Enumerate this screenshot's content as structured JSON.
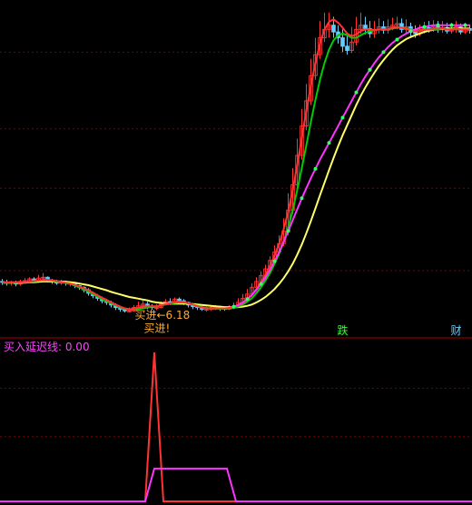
{
  "chart_data": [
    {
      "type": "line",
      "panel": "main",
      "description_note": "",
      "x": [
        0,
        1,
        2,
        3,
        4,
        5,
        6,
        7,
        8,
        9,
        10,
        11,
        12,
        13,
        14,
        15,
        16,
        17,
        18,
        19,
        20,
        21,
        22,
        23,
        24,
        25,
        26,
        27,
        28,
        29,
        30,
        31,
        32,
        33,
        34,
        35,
        36,
        37,
        38,
        39,
        40,
        41,
        42,
        43,
        44,
        45,
        46,
        47,
        48,
        49,
        50,
        51,
        52,
        53,
        54,
        55,
        56,
        57,
        58,
        59,
        60,
        61,
        62,
        63,
        64,
        65,
        66,
        67,
        68,
        69,
        70,
        71,
        72,
        73,
        74,
        75,
        76,
        77,
        78,
        79,
        80,
        81,
        82,
        83,
        84,
        85,
        86,
        87,
        88,
        89,
        90,
        91,
        92,
        93,
        94,
        95,
        96,
        97,
        98,
        99,
        100,
        101,
        102,
        103
      ],
      "candles": {
        "open": [
          6.9,
          6.88,
          6.86,
          6.88,
          6.84,
          6.9,
          6.92,
          6.96,
          6.92,
          6.98,
          7.0,
          6.92,
          6.9,
          6.86,
          6.9,
          6.86,
          6.86,
          6.8,
          6.76,
          6.7,
          6.62,
          6.56,
          6.5,
          6.44,
          6.4,
          6.34,
          6.28,
          6.24,
          6.2,
          6.2,
          6.28,
          6.32,
          6.36,
          6.3,
          6.28,
          6.28,
          6.36,
          6.42,
          6.4,
          6.48,
          6.44,
          6.4,
          6.34,
          6.3,
          6.28,
          6.24,
          6.24,
          6.28,
          6.28,
          6.26,
          6.24,
          6.28,
          6.3,
          6.4,
          6.5,
          6.6,
          6.76,
          6.9,
          7.04,
          7.2,
          7.4,
          7.6,
          7.8,
          8.1,
          8.6,
          9.2,
          9.9,
          10.6,
          11.2,
          11.8,
          12.3,
          12.7,
          12.9,
          13.0,
          12.84,
          12.7,
          12.5,
          12.4,
          12.6,
          12.9,
          13.0,
          12.92,
          12.8,
          12.9,
          12.96,
          12.88,
          12.96,
          13.0,
          13.04,
          12.9,
          12.96,
          12.84,
          12.8,
          12.86,
          12.94,
          12.9,
          12.96,
          12.9,
          12.94,
          12.86,
          12.9,
          12.96,
          12.84,
          12.92
        ],
        "close": [
          6.88,
          6.86,
          6.88,
          6.84,
          6.9,
          6.92,
          6.96,
          6.92,
          6.98,
          7.0,
          6.92,
          6.9,
          6.86,
          6.9,
          6.86,
          6.86,
          6.8,
          6.76,
          6.7,
          6.62,
          6.56,
          6.5,
          6.44,
          6.4,
          6.34,
          6.28,
          6.24,
          6.2,
          6.2,
          6.28,
          6.32,
          6.36,
          6.3,
          6.28,
          6.28,
          6.36,
          6.42,
          6.4,
          6.48,
          6.44,
          6.4,
          6.34,
          6.3,
          6.28,
          6.24,
          6.24,
          6.28,
          6.28,
          6.26,
          6.24,
          6.28,
          6.3,
          6.4,
          6.5,
          6.6,
          6.76,
          6.9,
          7.04,
          7.2,
          7.4,
          7.6,
          7.8,
          8.1,
          8.6,
          9.2,
          9.9,
          10.6,
          11.2,
          11.8,
          12.3,
          12.7,
          12.9,
          13.0,
          12.84,
          12.7,
          12.5,
          12.4,
          12.6,
          12.9,
          13.0,
          12.92,
          12.8,
          12.9,
          12.96,
          12.88,
          12.96,
          13.0,
          13.04,
          12.9,
          12.96,
          12.84,
          12.8,
          12.86,
          12.94,
          12.9,
          12.96,
          12.9,
          12.94,
          12.86,
          12.9,
          12.96,
          12.84,
          12.92,
          12.88
        ],
        "high": [
          6.96,
          6.94,
          6.92,
          6.92,
          6.94,
          6.98,
          7.0,
          7.0,
          7.06,
          7.1,
          7.02,
          6.96,
          6.94,
          6.94,
          6.92,
          6.9,
          6.88,
          6.82,
          6.78,
          6.74,
          6.66,
          6.6,
          6.54,
          6.48,
          6.44,
          6.38,
          6.32,
          6.28,
          6.28,
          6.34,
          6.42,
          6.44,
          6.42,
          6.36,
          6.36,
          6.42,
          6.48,
          6.5,
          6.52,
          6.52,
          6.48,
          6.42,
          6.38,
          6.34,
          6.32,
          6.3,
          6.32,
          6.34,
          6.32,
          6.3,
          6.34,
          6.4,
          6.5,
          6.6,
          6.72,
          6.86,
          7.0,
          7.14,
          7.3,
          7.5,
          7.76,
          8.0,
          8.4,
          9.0,
          9.6,
          10.3,
          11.0,
          11.6,
          12.2,
          12.7,
          13.1,
          13.3,
          13.3,
          13.2,
          13.0,
          12.9,
          12.8,
          12.96,
          13.2,
          13.3,
          13.2,
          13.1,
          13.1,
          13.16,
          13.1,
          13.14,
          13.18,
          13.2,
          13.16,
          13.14,
          13.06,
          13.0,
          13.02,
          13.08,
          13.1,
          13.12,
          13.1,
          13.1,
          13.06,
          13.06,
          13.1,
          13.04,
          13.06,
          13.02
        ],
        "low": [
          6.82,
          6.8,
          6.8,
          6.78,
          6.8,
          6.86,
          6.88,
          6.88,
          6.9,
          6.92,
          6.88,
          6.84,
          6.82,
          6.82,
          6.8,
          6.78,
          6.74,
          6.7,
          6.64,
          6.56,
          6.5,
          6.44,
          6.38,
          6.34,
          6.28,
          6.22,
          6.18,
          6.16,
          6.16,
          6.18,
          6.24,
          6.28,
          6.24,
          6.22,
          6.22,
          6.26,
          6.34,
          6.34,
          6.36,
          6.38,
          6.34,
          6.28,
          6.24,
          6.22,
          6.2,
          6.18,
          6.2,
          6.22,
          6.2,
          6.2,
          6.22,
          6.24,
          6.28,
          6.36,
          6.44,
          6.54,
          6.68,
          6.82,
          6.96,
          7.14,
          7.32,
          7.5,
          7.74,
          8.0,
          8.5,
          9.1,
          9.8,
          10.5,
          11.1,
          11.7,
          12.2,
          12.6,
          12.7,
          12.7,
          12.56,
          12.36,
          12.3,
          12.34,
          12.52,
          12.8,
          12.78,
          12.7,
          12.7,
          12.8,
          12.8,
          12.8,
          12.88,
          12.9,
          12.82,
          12.8,
          12.74,
          12.7,
          12.74,
          12.8,
          12.82,
          12.84,
          12.82,
          12.82,
          12.8,
          12.8,
          12.82,
          12.78,
          12.8,
          12.8
        ]
      },
      "series": [
        {
          "name": "",
          "color": "#ffff66",
          "values": [
            6.87,
            6.87,
            6.87,
            6.87,
            6.87,
            6.87,
            6.88,
            6.88,
            6.89,
            6.9,
            6.9,
            6.9,
            6.9,
            6.9,
            6.89,
            6.88,
            6.87,
            6.85,
            6.83,
            6.81,
            6.78,
            6.75,
            6.72,
            6.69,
            6.65,
            6.62,
            6.59,
            6.56,
            6.53,
            6.51,
            6.49,
            6.47,
            6.45,
            6.42,
            6.4,
            6.39,
            6.38,
            6.37,
            6.37,
            6.37,
            6.37,
            6.37,
            6.36,
            6.35,
            6.34,
            6.33,
            6.32,
            6.31,
            6.3,
            6.29,
            6.29,
            6.28,
            6.29,
            6.3,
            6.32,
            6.35,
            6.4,
            6.46,
            6.53,
            6.62,
            6.72,
            6.84,
            6.98,
            7.14,
            7.32,
            7.54,
            7.78,
            8.05,
            8.34,
            8.64,
            8.95,
            9.25,
            9.55,
            9.84,
            10.12,
            10.38,
            10.62,
            10.86,
            11.1,
            11.32,
            11.52,
            11.7,
            11.87,
            12.03,
            12.17,
            12.3,
            12.42,
            12.52,
            12.6,
            12.67,
            12.72,
            12.76,
            12.8,
            12.84,
            12.87,
            12.89,
            12.9,
            12.91,
            12.92,
            12.92,
            12.92,
            12.92,
            12.92,
            12.92
          ]
        },
        {
          "name": "",
          "color": "#00cc00",
          "values": [
            6.87,
            6.87,
            6.87,
            6.87,
            6.88,
            6.88,
            6.89,
            6.9,
            6.92,
            6.93,
            6.93,
            6.92,
            6.9,
            6.88,
            6.86,
            6.84,
            6.8,
            6.76,
            6.71,
            6.66,
            6.6,
            6.54,
            6.48,
            6.43,
            6.38,
            6.33,
            6.28,
            6.25,
            6.23,
            6.23,
            6.24,
            6.26,
            6.28,
            6.3,
            6.31,
            6.33,
            6.35,
            6.37,
            6.39,
            6.4,
            6.4,
            6.38,
            6.35,
            6.32,
            6.29,
            6.27,
            6.25,
            6.25,
            6.25,
            6.25,
            6.26,
            6.27,
            6.3,
            6.35,
            6.42,
            6.5,
            6.62,
            6.76,
            6.92,
            7.1,
            7.32,
            7.56,
            7.84,
            8.18,
            8.6,
            9.08,
            9.6,
            10.14,
            10.7,
            11.22,
            11.7,
            12.1,
            12.42,
            12.64,
            12.76,
            12.8,
            12.76,
            12.7,
            12.7,
            12.76,
            12.82,
            12.86,
            12.88,
            12.9,
            12.9,
            12.9,
            12.92,
            12.94,
            12.94,
            12.92,
            12.9,
            12.88,
            12.88,
            12.9,
            12.9,
            12.9,
            12.9,
            12.92,
            12.9,
            12.9,
            12.9,
            12.9,
            12.9,
            12.9
          ]
        },
        {
          "name": "",
          "color": "#ff3333",
          "values": [
            6.88,
            6.88,
            6.88,
            6.88,
            6.88,
            6.89,
            6.9,
            6.91,
            6.92,
            6.94,
            6.94,
            6.93,
            6.91,
            6.89,
            6.87,
            6.85,
            6.82,
            6.78,
            6.74,
            6.69,
            6.63,
            6.57,
            6.51,
            6.46,
            6.4,
            6.35,
            6.3,
            6.26,
            6.24,
            6.25,
            6.27,
            6.3,
            6.31,
            6.31,
            6.31,
            6.33,
            6.36,
            6.38,
            6.41,
            6.42,
            6.41,
            6.38,
            6.35,
            6.31,
            6.28,
            6.26,
            6.25,
            6.26,
            6.26,
            6.26,
            6.27,
            6.29,
            6.33,
            6.39,
            6.47,
            6.58,
            6.72,
            6.88,
            7.06,
            7.28,
            7.52,
            7.8,
            8.14,
            8.56,
            9.08,
            9.68,
            10.32,
            10.96,
            11.56,
            12.1,
            12.56,
            12.9,
            13.08,
            13.14,
            13.06,
            12.94,
            12.8,
            12.74,
            12.78,
            12.86,
            12.9,
            12.9,
            12.88,
            12.9,
            12.9,
            12.9,
            12.94,
            12.96,
            12.94,
            12.92,
            12.88,
            12.86,
            12.88,
            12.9,
            12.9,
            12.92,
            12.92,
            12.92,
            12.9,
            12.9,
            12.92,
            12.9,
            12.9,
            12.9
          ]
        },
        {
          "name": "",
          "color": "#ff33ff",
          "values": [
            null,
            null,
            null,
            null,
            null,
            null,
            null,
            null,
            null,
            null,
            null,
            null,
            null,
            null,
            null,
            null,
            null,
            null,
            null,
            null,
            null,
            null,
            null,
            null,
            null,
            null,
            null,
            null,
            null,
            null,
            null,
            null,
            null,
            null,
            null,
            null,
            null,
            null,
            null,
            null,
            null,
            null,
            null,
            null,
            null,
            null,
            null,
            null,
            null,
            null,
            null,
            6.3,
            6.34,
            6.4,
            6.48,
            6.58,
            6.7,
            6.84,
            7.0,
            7.18,
            7.38,
            7.6,
            7.84,
            8.1,
            8.36,
            8.62,
            8.88,
            9.12,
            9.36,
            9.58,
            9.8,
            10.0,
            10.2,
            10.4,
            10.6,
            10.8,
            11.0,
            11.2,
            11.4,
            11.6,
            11.78,
            11.94,
            12.1,
            12.24,
            12.36,
            12.48,
            12.58,
            12.66,
            12.74,
            12.8,
            12.86,
            12.9,
            12.94,
            12.96,
            12.98,
            13.0,
            13.0,
            13.0,
            13.0,
            13.0,
            13.0,
            13.0,
            13.0,
            13.0
          ]
        }
      ],
      "annotations": [
        {
          "text": "买进←6.18",
          "x": 34,
          "y": 6.18,
          "color": "#ffaa33"
        },
        {
          "text": "买进!",
          "x": 36,
          "y": 6.0,
          "color": "#ffaa33"
        }
      ],
      "markers": [
        {
          "text": "跌",
          "x": 75,
          "color": "#33ff33"
        },
        {
          "text": "财",
          "x": 100,
          "color": "#66ccff"
        }
      ],
      "ylim": [
        5.6,
        13.6
      ],
      "grid": true,
      "log_scale": false
    },
    {
      "type": "line",
      "panel": "indicator",
      "title": "买入延迟线: 0.00",
      "series": [
        {
          "name": "买入延迟线",
          "color": "#ff3333",
          "values_x": [
            0,
            32,
            34,
            36,
            40,
            104
          ],
          "values_y": [
            0,
            0,
            1,
            0,
            0,
            0
          ],
          "kind": "spike"
        },
        {
          "name": "",
          "color": "#ff33ff",
          "values_x": [
            0,
            32,
            34,
            50,
            52,
            104
          ],
          "values_y": [
            0,
            0,
            0.22,
            0.22,
            0,
            0
          ],
          "kind": "plateau"
        }
      ],
      "ylim": [
        0,
        1
      ],
      "grid": true
    }
  ],
  "indicator_label": "买入延迟线: 0.00",
  "colors": {
    "up": "#ff3333",
    "down": "#66ccff",
    "grid": "#7a0000",
    "divider": "#aa0000",
    "background": "#000000"
  }
}
